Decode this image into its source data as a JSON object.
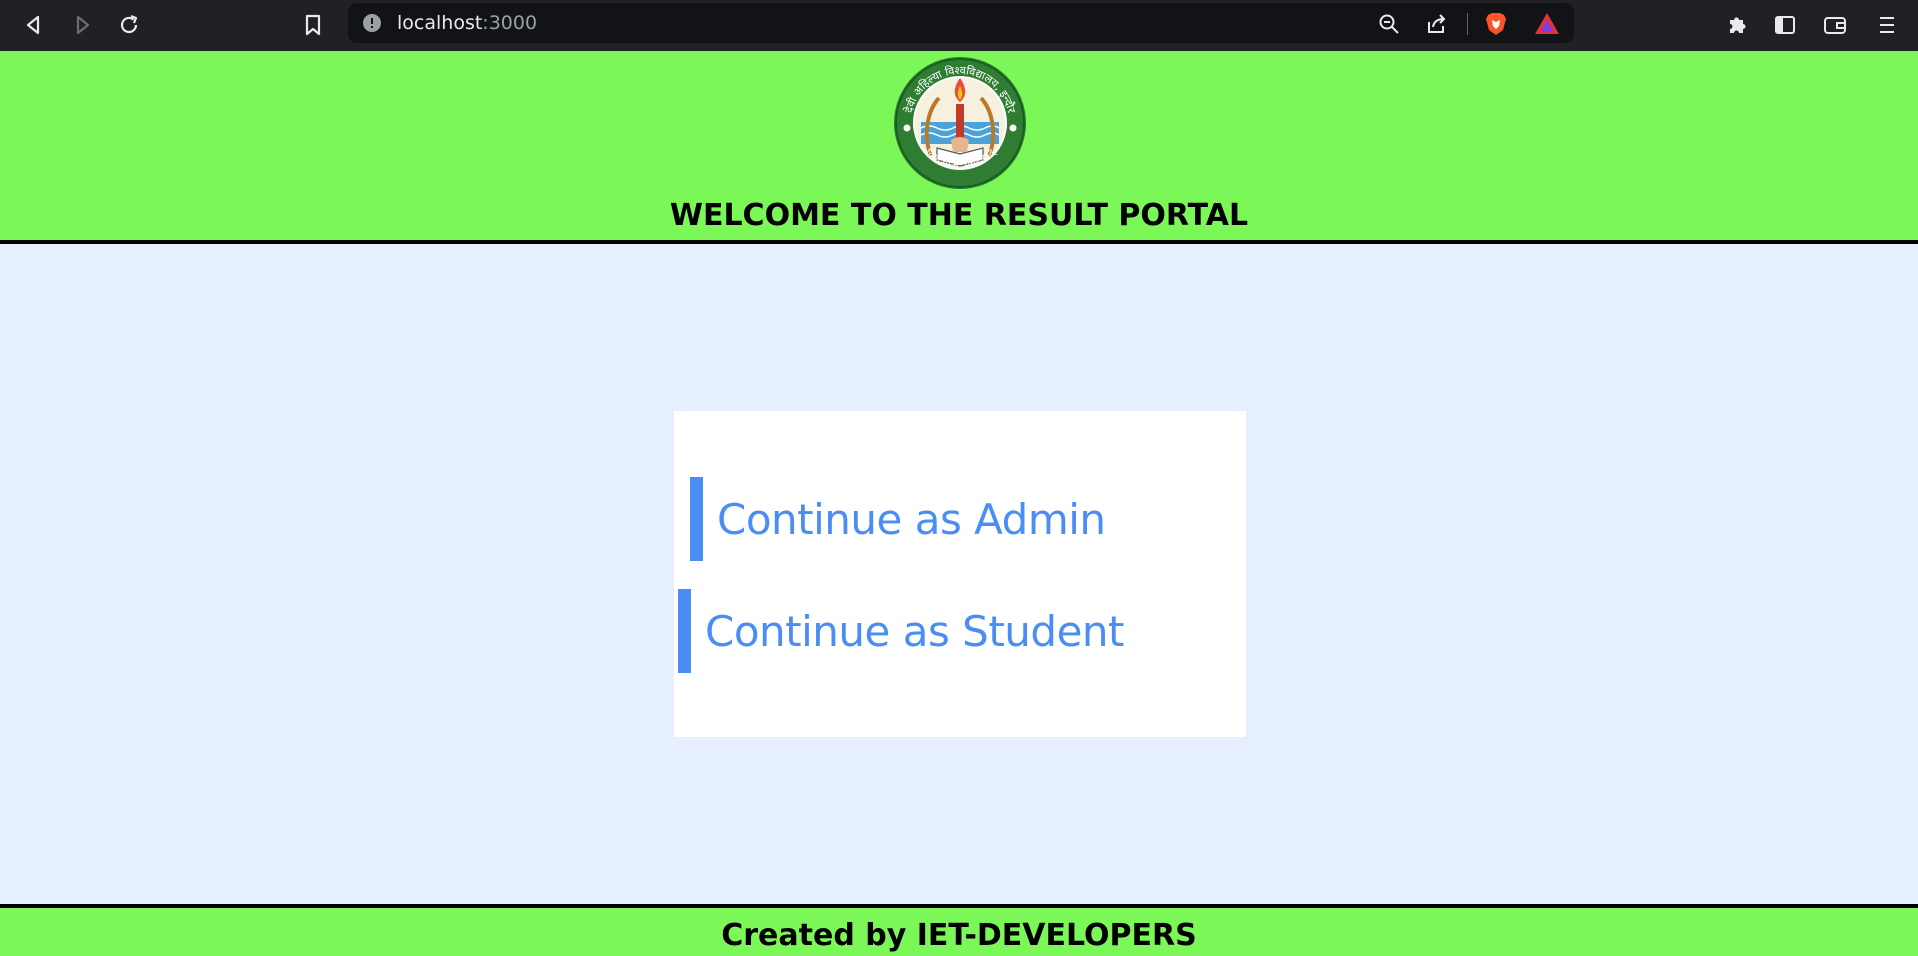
{
  "browser": {
    "url_host": "localhost",
    "url_port": ":3000",
    "icons": [
      "back-icon",
      "forward-icon",
      "reload-icon",
      "bookmark-icon",
      "info-icon",
      "zoom-out-icon",
      "share-icon",
      "brave-shield-icon",
      "brave-rewards-icon",
      "extensions-icon",
      "sidebar-icon",
      "wallet-icon",
      "menu-icon"
    ]
  },
  "header": {
    "title": "WELCOME TO THE RESULT PORTAL",
    "logo_top_text": "देवी अहिल्या विश्वविद्यालय, इन्दौर",
    "logo_bottom_text": "विद्या यो न: प्रचोदयात्"
  },
  "login": {
    "admin_label": "Continue as Admin",
    "student_label": "Continue as Student"
  },
  "footer": {
    "text": "Created by IET-DEVELOPERS"
  },
  "colors": {
    "header_bg": "#7cf758",
    "page_bg": "#e6efff",
    "accent": "#4a8df5",
    "chrome_bg": "#202124"
  }
}
